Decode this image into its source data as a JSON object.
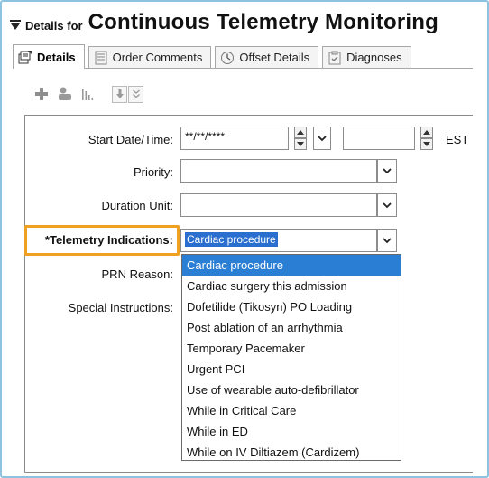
{
  "header": {
    "prefix": "Details for",
    "title": "Continuous Telemetry Monitoring"
  },
  "tabs": [
    {
      "label": "Details",
      "active": true,
      "icon": "details-icon"
    },
    {
      "label": "Order Comments",
      "active": false,
      "icon": "comments-icon"
    },
    {
      "label": "Offset Details",
      "active": false,
      "icon": "offset-icon"
    },
    {
      "label": "Diagnoses",
      "active": false,
      "icon": "diagnoses-icon"
    }
  ],
  "toolbar": {
    "icons": [
      "add-icon",
      "link-icon",
      "chart-icon",
      "move-down-icon",
      "expand-icon"
    ]
  },
  "form": {
    "start_datetime": {
      "label": "Start Date/Time:",
      "date_value": "**/**/****",
      "time_value": "",
      "timezone": "EST"
    },
    "priority": {
      "label": "Priority:",
      "value": ""
    },
    "duration_unit": {
      "label": "Duration Unit:",
      "value": ""
    },
    "telemetry_indications": {
      "label": "*Telemetry Indications:",
      "value": "Cardiac procedure"
    },
    "prn_reason": {
      "label": "PRN Reason:"
    },
    "special_instructions": {
      "label": "Special Instructions:"
    }
  },
  "dropdown": {
    "options": [
      "Cardiac procedure",
      "Cardiac surgery this admission",
      "Dofetilide (Tikosyn) PO Loading",
      "Post ablation of an arrhythmia",
      "Temporary Pacemaker",
      "Urgent PCI",
      "Use of wearable auto-defibrillator",
      "While in Critical Care",
      "While in ED",
      "While on IV Diltiazem (Cardizem)"
    ],
    "selected_index": 0
  },
  "colors": {
    "highlight_border": "#f0a020",
    "selection": "#2a7fd4",
    "frame_border": "#8ec3e0"
  }
}
